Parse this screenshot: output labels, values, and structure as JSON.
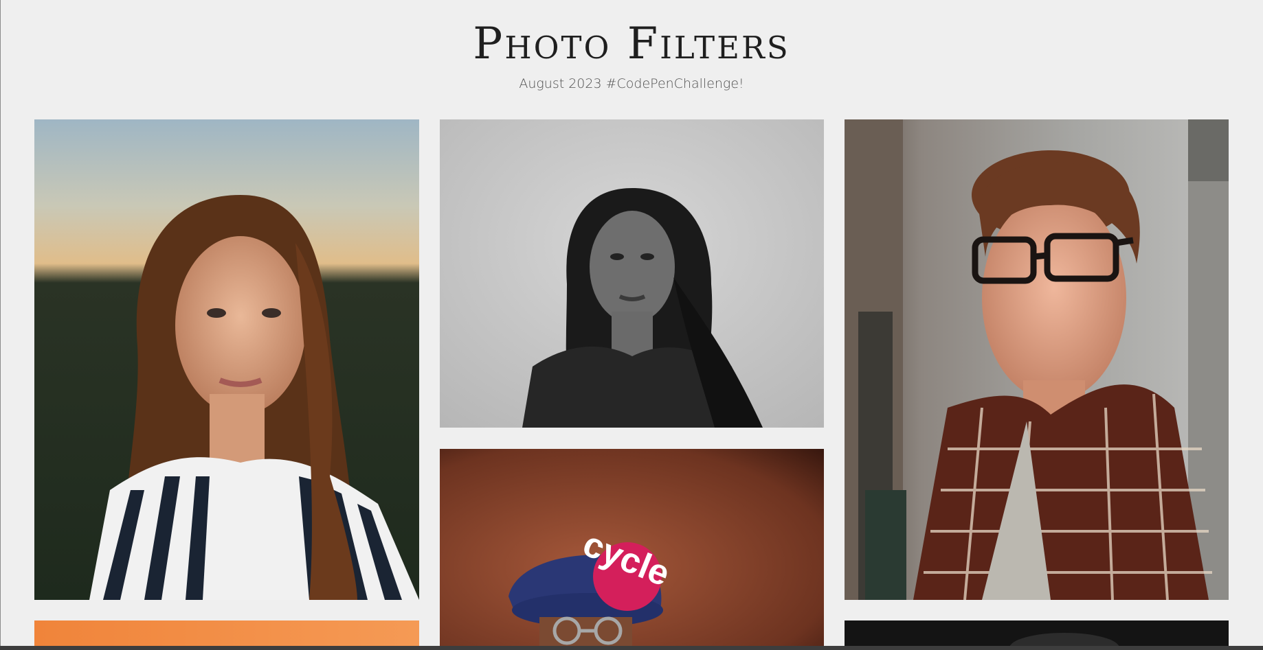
{
  "header": {
    "title": "Photo Filters",
    "subtitle": "August 2023 #CodePenChallenge!"
  },
  "badge": {
    "text": "cycle",
    "color": "#d41f5b"
  },
  "photos": [
    {
      "subject": "woman with long brown hair in striped shirt at sunset",
      "icon": "portrait-photo"
    },
    {
      "subject": "black and white portrait of woman with long hair",
      "icon": "portrait-photo"
    },
    {
      "subject": "young man with glasses in plaid shirt leaning on wall",
      "icon": "portrait-photo"
    },
    {
      "subject": "man in blue beret with glasses on brown background",
      "icon": "portrait-photo"
    },
    {
      "subject": "orange background photo",
      "icon": "portrait-photo"
    },
    {
      "subject": "dark background photo",
      "icon": "portrait-photo"
    }
  ],
  "colors": {
    "background": "#efefef",
    "title": "#1f1f1f",
    "subtitle": "#505050"
  }
}
